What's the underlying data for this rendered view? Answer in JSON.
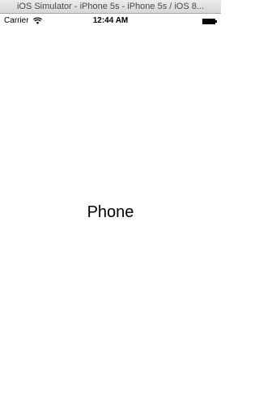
{
  "window": {
    "title": "iOS Simulator - iPhone 5s - iPhone 5s / iOS 8..."
  },
  "status_bar": {
    "carrier": "Carrier",
    "time": "12:44 AM",
    "wifi_icon": "wifi-icon",
    "battery_icon": "battery-icon"
  },
  "content": {
    "label": "Phone"
  }
}
